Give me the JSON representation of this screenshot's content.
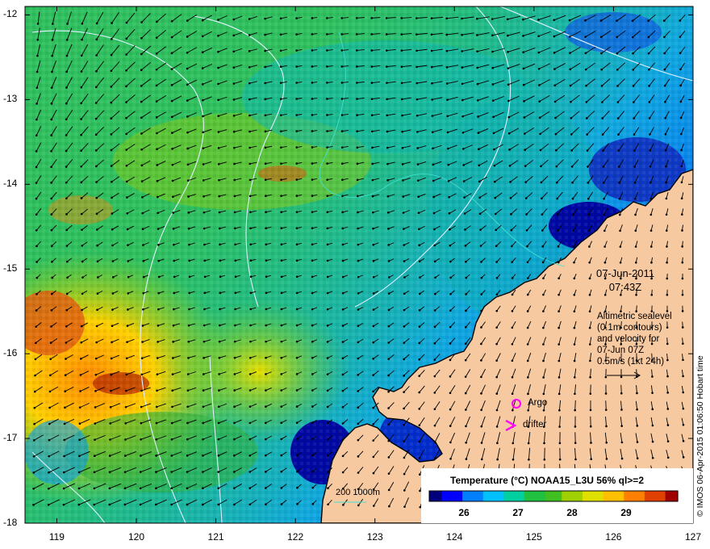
{
  "map": {
    "date": "07-Jun-2011",
    "time": "07:43Z",
    "altimetry_text": [
      "Altimetric sealevel",
      "(0.1m contours)",
      "and velocity for",
      "07-Jun 07Z",
      "0.5m/s (1kt 24h)"
    ],
    "credit": "© IMOS 06-Apr-2015 01:06:50 Hobart time",
    "scale_label": "200  1000m",
    "legend": {
      "argo_label": "Argo",
      "drifter_label": "drifter"
    }
  },
  "axes": {
    "lat_ticks": [
      "-12",
      "-13",
      "-14",
      "-15",
      "-16",
      "-17",
      "-18"
    ],
    "lon_ticks": [
      "119",
      "120",
      "121",
      "122",
      "123",
      "124",
      "125",
      "126",
      "127"
    ],
    "lat_range": [
      -18,
      -11.9
    ],
    "lon_range": [
      118.6,
      127
    ]
  },
  "colorbar": {
    "title": "Temperature (°C) NOAA15_L3U 56% ql>=2",
    "ticks": [
      "26",
      "27",
      "28",
      "29"
    ],
    "colors": [
      "#00007f",
      "#0000ff",
      "#0080ff",
      "#00c0ff",
      "#00d0a0",
      "#20c040",
      "#40c020",
      "#a0d000",
      "#e0e000",
      "#ffc000",
      "#ff8000",
      "#e04000",
      "#a00000"
    ]
  },
  "colors": {
    "land": "#f7c9a1",
    "land_edge": "#000000",
    "contour": "#e0f0ff",
    "isobath": "#40e0d0",
    "argo": "#ff00ff"
  }
}
